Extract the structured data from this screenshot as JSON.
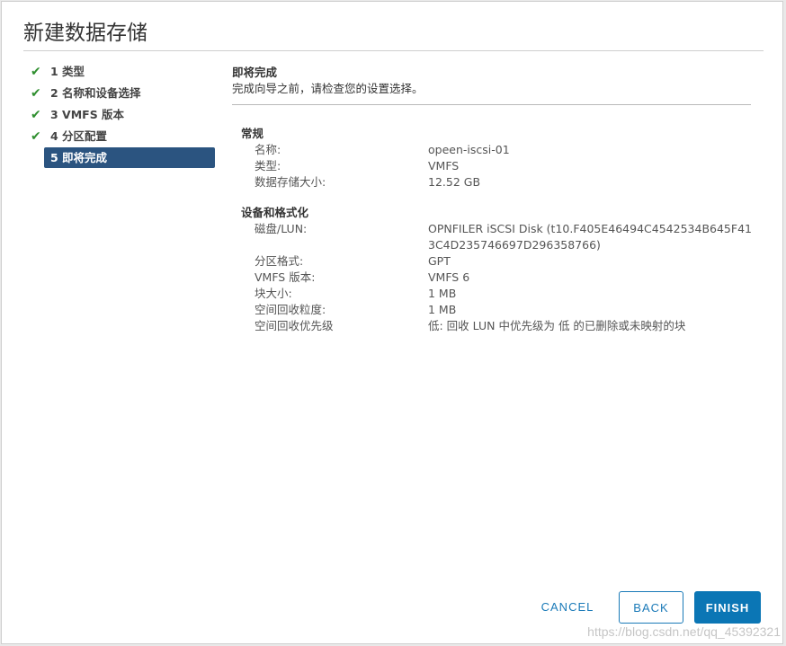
{
  "dialog": {
    "title": "新建数据存储"
  },
  "steps": [
    {
      "label": "1 类型",
      "completed": true
    },
    {
      "label": "2 名称和设备选择",
      "completed": true
    },
    {
      "label": "3 VMFS 版本",
      "completed": true
    },
    {
      "label": "4 分区配置",
      "completed": true
    },
    {
      "label": "5 即将完成",
      "completed": false,
      "active": true
    }
  ],
  "panel": {
    "title": "即将完成",
    "subtitle": "完成向导之前，请检查您的设置选择。"
  },
  "general": {
    "heading": "常规",
    "rows": [
      {
        "key": "名称:",
        "value": "opeen-iscsi-01"
      },
      {
        "key": "类型:",
        "value": "VMFS"
      },
      {
        "key": "数据存储大小:",
        "value": "12.52 GB"
      }
    ]
  },
  "device": {
    "heading": "设备和格式化",
    "rows": [
      {
        "key": "磁盘/LUN:",
        "value": "OPNFILER iSCSI Disk (t10.F405E46494C4542534B645F413C4D235746697D296358766)"
      },
      {
        "key": "分区格式:",
        "value": "GPT"
      },
      {
        "key": "VMFS 版本:",
        "value": "VMFS 6"
      },
      {
        "key": "块大小:",
        "value": "1 MB"
      },
      {
        "key": "空间回收粒度:",
        "value": "1 MB"
      },
      {
        "key": "空间回收优先级",
        "value": "低: 回收 LUN 中优先级为 低 的已删除或未映射的块"
      }
    ]
  },
  "footer": {
    "cancel": "CANCEL",
    "back": "BACK",
    "finish": "FINISH"
  },
  "watermark": "https://blog.csdn.net/qq_45392321",
  "colors": {
    "accent": "#0b76b5",
    "active_step": "#2b5480",
    "check": "#2f8f2f"
  },
  "icons": {
    "step_complete": "check-icon"
  }
}
